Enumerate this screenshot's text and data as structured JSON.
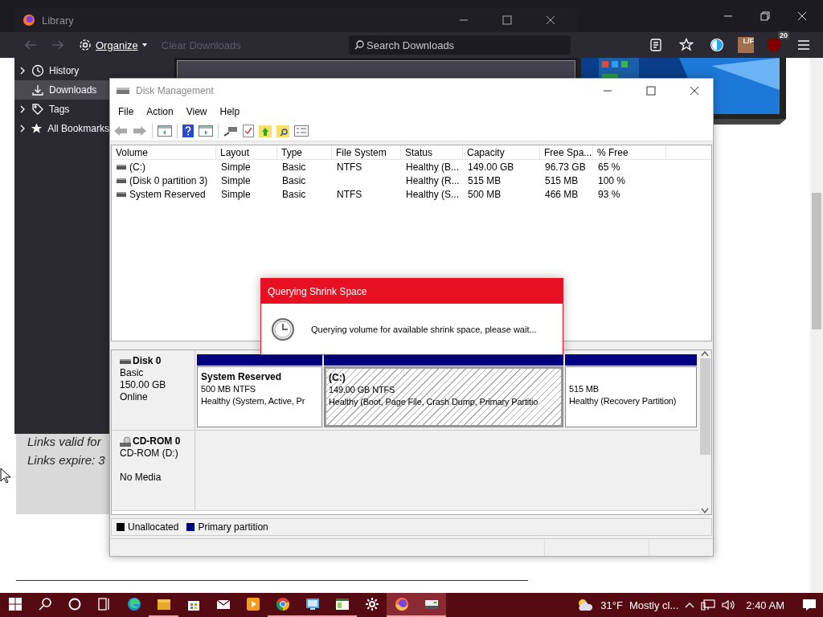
{
  "browser": {
    "extension_label": "L/F",
    "blocker_badge": "20",
    "page_lines": [
      "Links valid for",
      "Links expire: 3"
    ]
  },
  "library": {
    "title": "Library",
    "organize": "Organize",
    "clear_downloads": {
      "label": "Clear Downloads",
      "disabled": true
    },
    "search_placeholder": "Search Downloads",
    "sidebar": [
      {
        "kind": "history",
        "label": "History",
        "expandable": true,
        "selected": false
      },
      {
        "kind": "downloads",
        "label": "Downloads",
        "expandable": false,
        "selected": true
      },
      {
        "kind": "tags",
        "label": "Tags",
        "expandable": true,
        "selected": false
      },
      {
        "kind": "bookmarks",
        "label": "All Bookmarks",
        "expandable": true,
        "selected": false
      }
    ]
  },
  "disk_management": {
    "title": "Disk Management",
    "menu": [
      "File",
      "Action",
      "View",
      "Help"
    ],
    "columns": [
      "Volume",
      "Layout",
      "Type",
      "File System",
      "Status",
      "Capacity",
      "Free Spa...",
      "% Free"
    ],
    "rows": [
      [
        "(C:)",
        "Simple",
        "Basic",
        "NTFS",
        "Healthy (B...",
        "149.00 GB",
        "96.73 GB",
        "65 %"
      ],
      [
        "(Disk 0 partition 3)",
        "Simple",
        "Basic",
        "",
        "Healthy (R...",
        "515 MB",
        "515 MB",
        "100 %"
      ],
      [
        "System Reserved",
        "Simple",
        "Basic",
        "NTFS",
        "Healthy (S...",
        "500 MB",
        "466 MB",
        "93 %"
      ]
    ],
    "disks": [
      {
        "kind": "disk",
        "name": "Disk 0",
        "type": "Basic",
        "size": "150.00 GB",
        "status": "Online",
        "partitions": [
          {
            "name": "System Reserved",
            "size": "500 MB NTFS",
            "status": "Healthy (System, Active, Pr",
            "selected": false
          },
          {
            "name": "(C:)",
            "size": "149.00 GB NTFS",
            "status": "Healthy (Boot, Page File, Crash Dump, Primary Partitio",
            "selected": true
          },
          {
            "size": "515 MB",
            "status": "Healthy (Recovery Partition)",
            "selected": false
          }
        ]
      },
      {
        "kind": "cdrom",
        "name": "CD-ROM 0",
        "type": "CD-ROM (D:)",
        "status": "No Media"
      }
    ],
    "legend": [
      {
        "label": "Unallocated",
        "color": "#000000"
      },
      {
        "label": "Primary partition",
        "color": "#000080"
      }
    ]
  },
  "dialog": {
    "title": "Querying Shrink Space",
    "message": "Querying volume for available shrink space, please wait..."
  },
  "taskbar": {
    "apps": [
      {
        "kind": "edge",
        "running": false,
        "active": false
      },
      {
        "kind": "explorer",
        "running": true,
        "active": false
      },
      {
        "kind": "store",
        "running": false,
        "active": false
      },
      {
        "kind": "mail",
        "running": false,
        "active": false
      },
      {
        "kind": "media",
        "running": false,
        "active": false
      },
      {
        "kind": "chrome",
        "running": true,
        "active": false
      },
      {
        "kind": "remote",
        "running": true,
        "active": false
      },
      {
        "kind": "window",
        "running": true,
        "active": false
      },
      {
        "kind": "settings",
        "running": false,
        "active": false
      },
      {
        "kind": "firefox",
        "running": true,
        "active": true
      },
      {
        "kind": "disk",
        "running": true,
        "active": true
      }
    ],
    "temperature": "31°F",
    "weather": "Mostly cl...",
    "time": "2:40 AM"
  }
}
